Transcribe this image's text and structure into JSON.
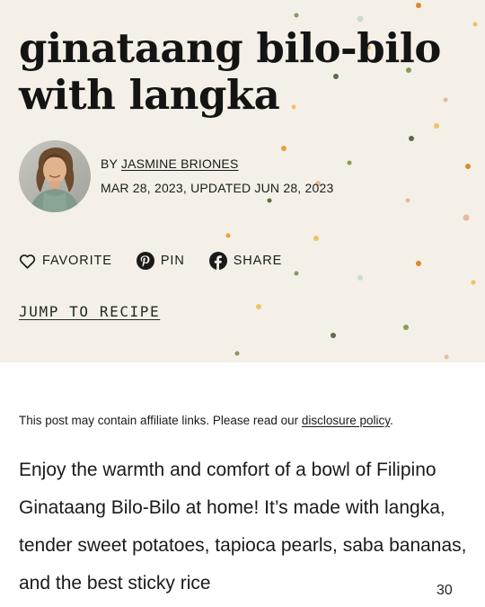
{
  "post": {
    "title": "ginataang bilo-bilo with langka",
    "byline_prefix": "BY",
    "author": "JASMINE BRIONES",
    "dates": "MAR 28, 2023, UPDATED JUN 28, 2023"
  },
  "actions": {
    "favorite": "FAVORITE",
    "pin": "PIN",
    "share": "SHARE"
  },
  "jump_link": "JUMP TO RECIPE",
  "disclosure": {
    "text": "This post may contain affiliate links. Please read our ",
    "link": "disclosure policy",
    "end": "."
  },
  "intro": "Enjoy the warmth and comfort of a bowl of Filipino Ginataang Bilo-Bilo at home! It’s made with langka, tender sweet potatoes, tapioca pearls, saba bananas, and the best sticky rice",
  "page_counter": "30",
  "icons": {
    "favorite": "heart-outline-icon",
    "pin": "pinterest-icon",
    "share": "facebook-icon"
  },
  "colors": {
    "hero_background": "#f4f0e7",
    "text": "#1a1a1a",
    "dot_palette": [
      "#e8a23a",
      "#8a9a5b",
      "#5d6b4a",
      "#f0c16a",
      "#b8cfc5",
      "#e6b9a0",
      "#d98a2e"
    ]
  }
}
